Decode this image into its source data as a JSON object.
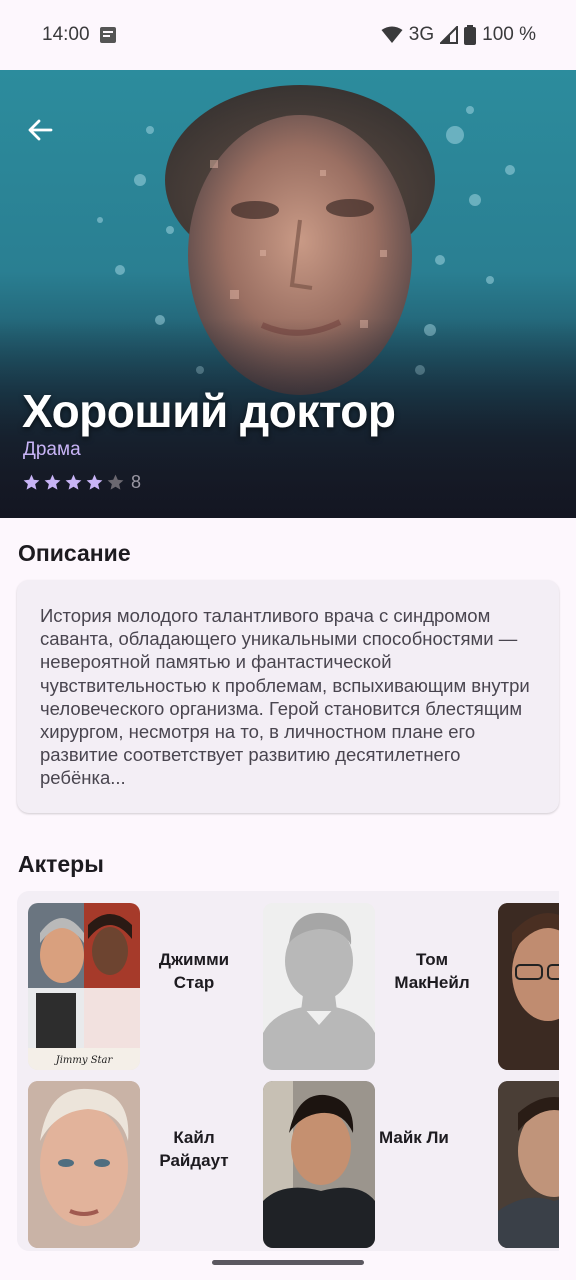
{
  "status_bar": {
    "time": "14:00",
    "network": "3G",
    "battery": "100 %"
  },
  "show": {
    "title": "Хороший доктор",
    "genre": "Драма",
    "rating_stars": 4,
    "rating_max": 5,
    "rating_value": "8"
  },
  "description": {
    "heading": "Описание",
    "text": "История молодого талантливого врача с синдромом саванта, обладающего уникальными способностями — невероятной памятью и фантастической чувствительностью к проблемам, вспыхивающим внутри человеческого организма. Герой становится блестящим хирургом, несмотря на то, в личностном плане его развитие соответствует развитию десятилетнего ребёнка..."
  },
  "actors": {
    "heading": "Актеры",
    "items": [
      {
        "name": "Джимми Стар",
        "photo_caption": "Jimmy Star"
      },
      {
        "name": "Том МакНейл"
      },
      {
        "name": "Кайл Райдаут"
      },
      {
        "name": "Майк Ли"
      }
    ]
  },
  "colors": {
    "accent": "#c8b4f6",
    "star_filled": "#c8b4f6",
    "star_empty": "#6b6870",
    "card_bg": "#f3eef5",
    "page_bg": "#fdf7fd"
  }
}
